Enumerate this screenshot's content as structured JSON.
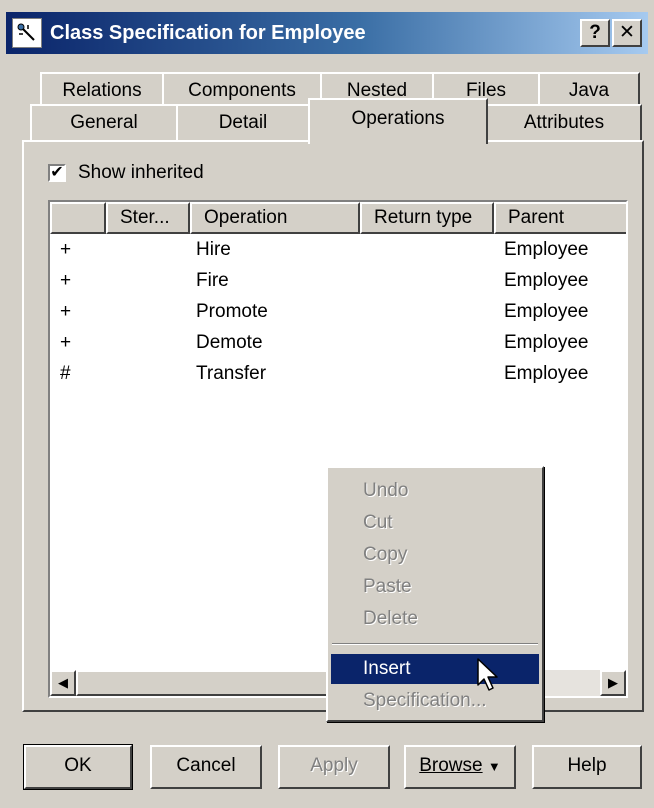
{
  "window": {
    "title": "Class Specification for Employee",
    "help_label": "?",
    "close_label": "✕"
  },
  "tabs_row1": [
    {
      "label": "Relations"
    },
    {
      "label": "Components"
    },
    {
      "label": "Nested"
    },
    {
      "label": "Files"
    },
    {
      "label": "Java"
    }
  ],
  "tabs_row2": [
    {
      "label": "General"
    },
    {
      "label": "Detail"
    },
    {
      "label": "Operations",
      "active": true
    },
    {
      "label": "Attributes"
    }
  ],
  "show_inherited": {
    "label": "Show inherited",
    "checked": true,
    "mark": "✔"
  },
  "table": {
    "columns": [
      "",
      "Ster...",
      "Operation",
      "Return type",
      "Parent"
    ],
    "rows": [
      {
        "visibility": "+",
        "stereotype": "",
        "operation": "Hire",
        "return_type": "",
        "parent": "Employee"
      },
      {
        "visibility": "+",
        "stereotype": "",
        "operation": "Fire",
        "return_type": "",
        "parent": "Employee"
      },
      {
        "visibility": "+",
        "stereotype": "",
        "operation": "Promote",
        "return_type": "",
        "parent": "Employee"
      },
      {
        "visibility": "+",
        "stereotype": "",
        "operation": "Demote",
        "return_type": "",
        "parent": "Employee"
      },
      {
        "visibility": "#",
        "stereotype": "",
        "operation": "Transfer",
        "return_type": "",
        "parent": "Employee"
      }
    ]
  },
  "context_menu": {
    "items": [
      {
        "label": "Undo",
        "enabled": false
      },
      {
        "label": "Cut",
        "enabled": false
      },
      {
        "label": "Copy",
        "enabled": false
      },
      {
        "label": "Paste",
        "enabled": false
      },
      {
        "label": "Delete",
        "enabled": false
      },
      {
        "label": "Insert",
        "enabled": true,
        "selected": true
      },
      {
        "label": "Specification...",
        "enabled": false
      }
    ]
  },
  "buttons": {
    "ok": "OK",
    "cancel": "Cancel",
    "apply": "Apply",
    "browse": "Browse",
    "browse_arrow": "▼",
    "help": "Help"
  },
  "icons": {
    "scroll_left": "◀",
    "scroll_right": "▶"
  }
}
